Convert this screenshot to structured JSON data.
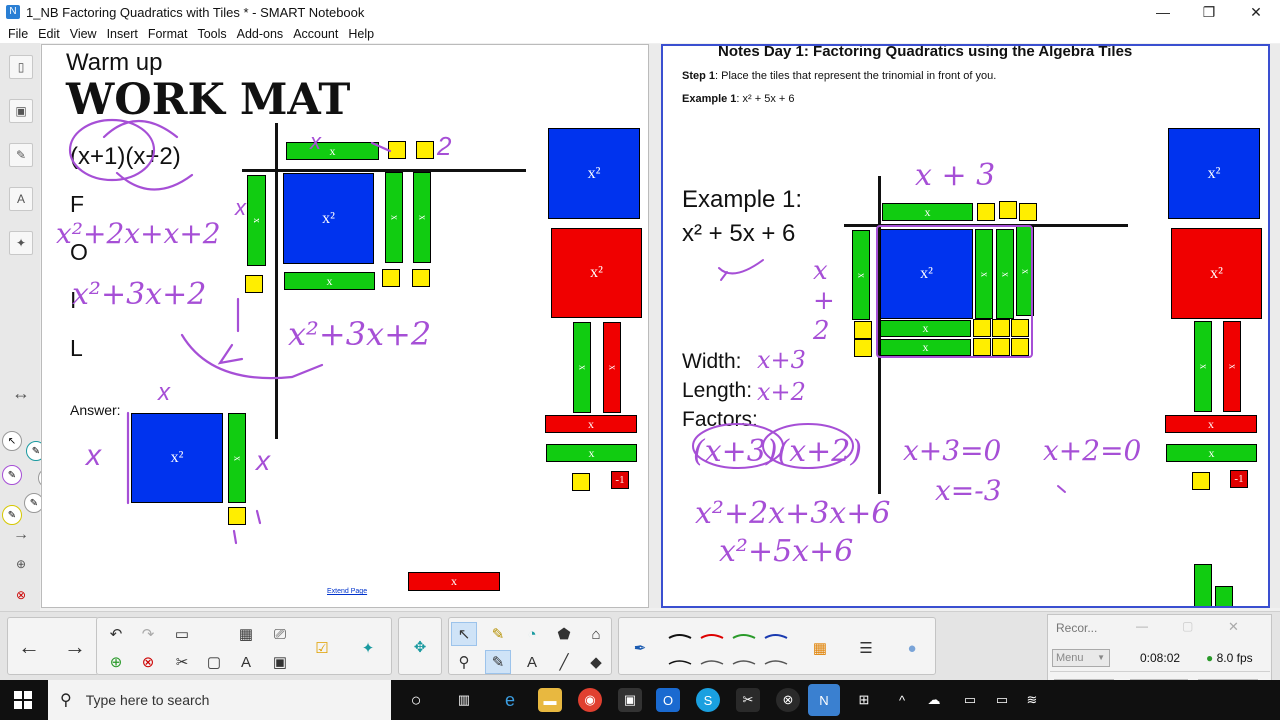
{
  "window": {
    "title": "1_NB Factoring Quadratics with Tiles * - SMART Notebook",
    "controls": {
      "minimize": "—",
      "maximize": "❐",
      "close": "✕"
    }
  },
  "menu": [
    "File",
    "Edit",
    "View",
    "Insert",
    "Format",
    "Tools",
    "Add-ons",
    "Account",
    "Help"
  ],
  "left_page": {
    "heading_small": "Warm up",
    "heading_large": "WORK MAT",
    "expression": "(x+1)(x+2)",
    "foil": [
      "F",
      "O",
      "I",
      "L"
    ],
    "answer_label": "Answer:",
    "extend_link": "Extend Page",
    "tile_x2": "x²",
    "tile_x": "x",
    "ink": {
      "foil_line": "x²+2x+x+2",
      "simplified": "x²+3x+2",
      "result": "x²+3x+2",
      "top_label": "x",
      "side_label_1": "x",
      "side_label_2": "x",
      "top_two": "2",
      "answer_top": "x",
      "answer_left": "x",
      "answer_right": "x"
    }
  },
  "right_page": {
    "header": "Notes Day 1: Factoring Quadratics using the Algebra Tiles",
    "step1_label": "Step 1",
    "step1_text": ": Place the tiles that represent the trinomial in front of you.",
    "example_label": "Example 1",
    "example_expr": ":  x² + 5x + 6",
    "big_example": "Example 1:",
    "big_expr": "x² + 5x + 6",
    "width_label": "Width:",
    "length_label": "Length:",
    "factors_label": "Factors:",
    "tile_x2": "x²",
    "tile_x": "x",
    "tile_neg1": "-1",
    "ink": {
      "top": "x + 3",
      "side": "x + 2",
      "width_val": "x+3",
      "length_val": "x+2",
      "factors": "(x+3)(x+2)",
      "eq1": "x+3=0",
      "eq2": "x+2=0",
      "sol1": "x=-3",
      "expand1": "x²+2x+3x+6",
      "expand2": "x²+5x+6"
    }
  },
  "recorder": {
    "title": "Recor...",
    "menu_label": "Menu",
    "time": "0:08:02",
    "fps": "8.0 fps"
  },
  "taskbar": {
    "search_placeholder": "Type here to search"
  },
  "colors": {
    "ink": "#a64fd6",
    "tile_blue": "#0033ee",
    "tile_red": "#f00000",
    "tile_green": "#11cc11",
    "tile_yellow": "#ffee00",
    "page_border_active": "#3a4fd0"
  }
}
